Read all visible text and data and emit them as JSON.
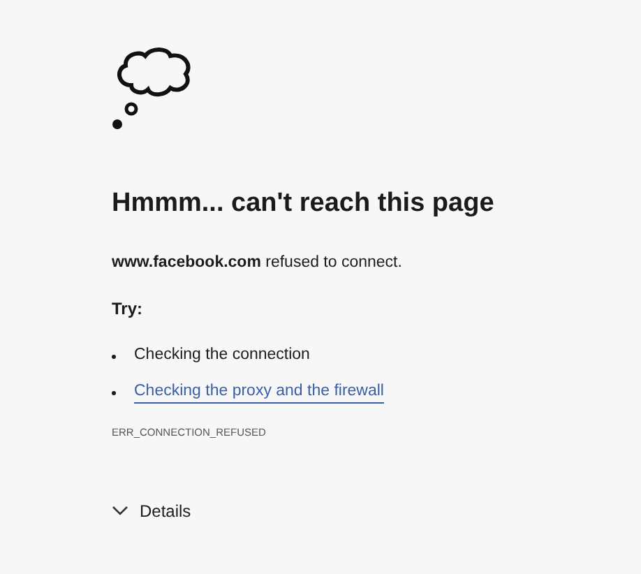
{
  "heading": "Hmmm... can't reach this page",
  "message": "**www.facebook.com** refused to connect.",
  "try_label": "Try:",
  "suggestions": [
    {
      "kind": "text",
      "text": "Checking the connection"
    },
    {
      "kind": "link",
      "text": "Checking the proxy and the firewall"
    }
  ],
  "error_code": "ERR_CONNECTION_REFUSED",
  "details": {
    "label": "Details",
    "expanded": false
  }
}
